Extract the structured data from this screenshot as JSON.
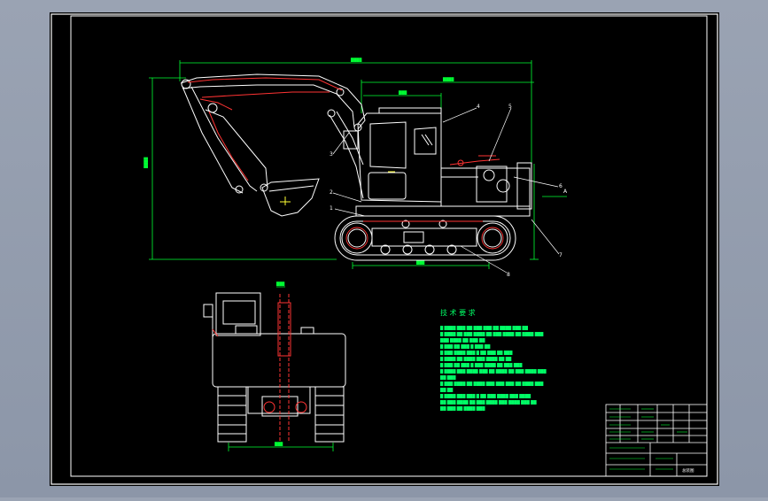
{
  "drawing": {
    "requirements_heading": "技 术 要 求",
    "callouts": [
      "1",
      "2",
      "3",
      "4",
      "5",
      "6",
      "7",
      "8"
    ],
    "section_marker": "A",
    "title_block_number": "总装图"
  },
  "colors": {
    "background": "#000000",
    "frame": "#ffffff",
    "geometry": "#ffffff",
    "hydraulic": "#ff3333",
    "dimension": "#00ff33",
    "callout": "#ffffff",
    "annotation": "#00ff66"
  }
}
